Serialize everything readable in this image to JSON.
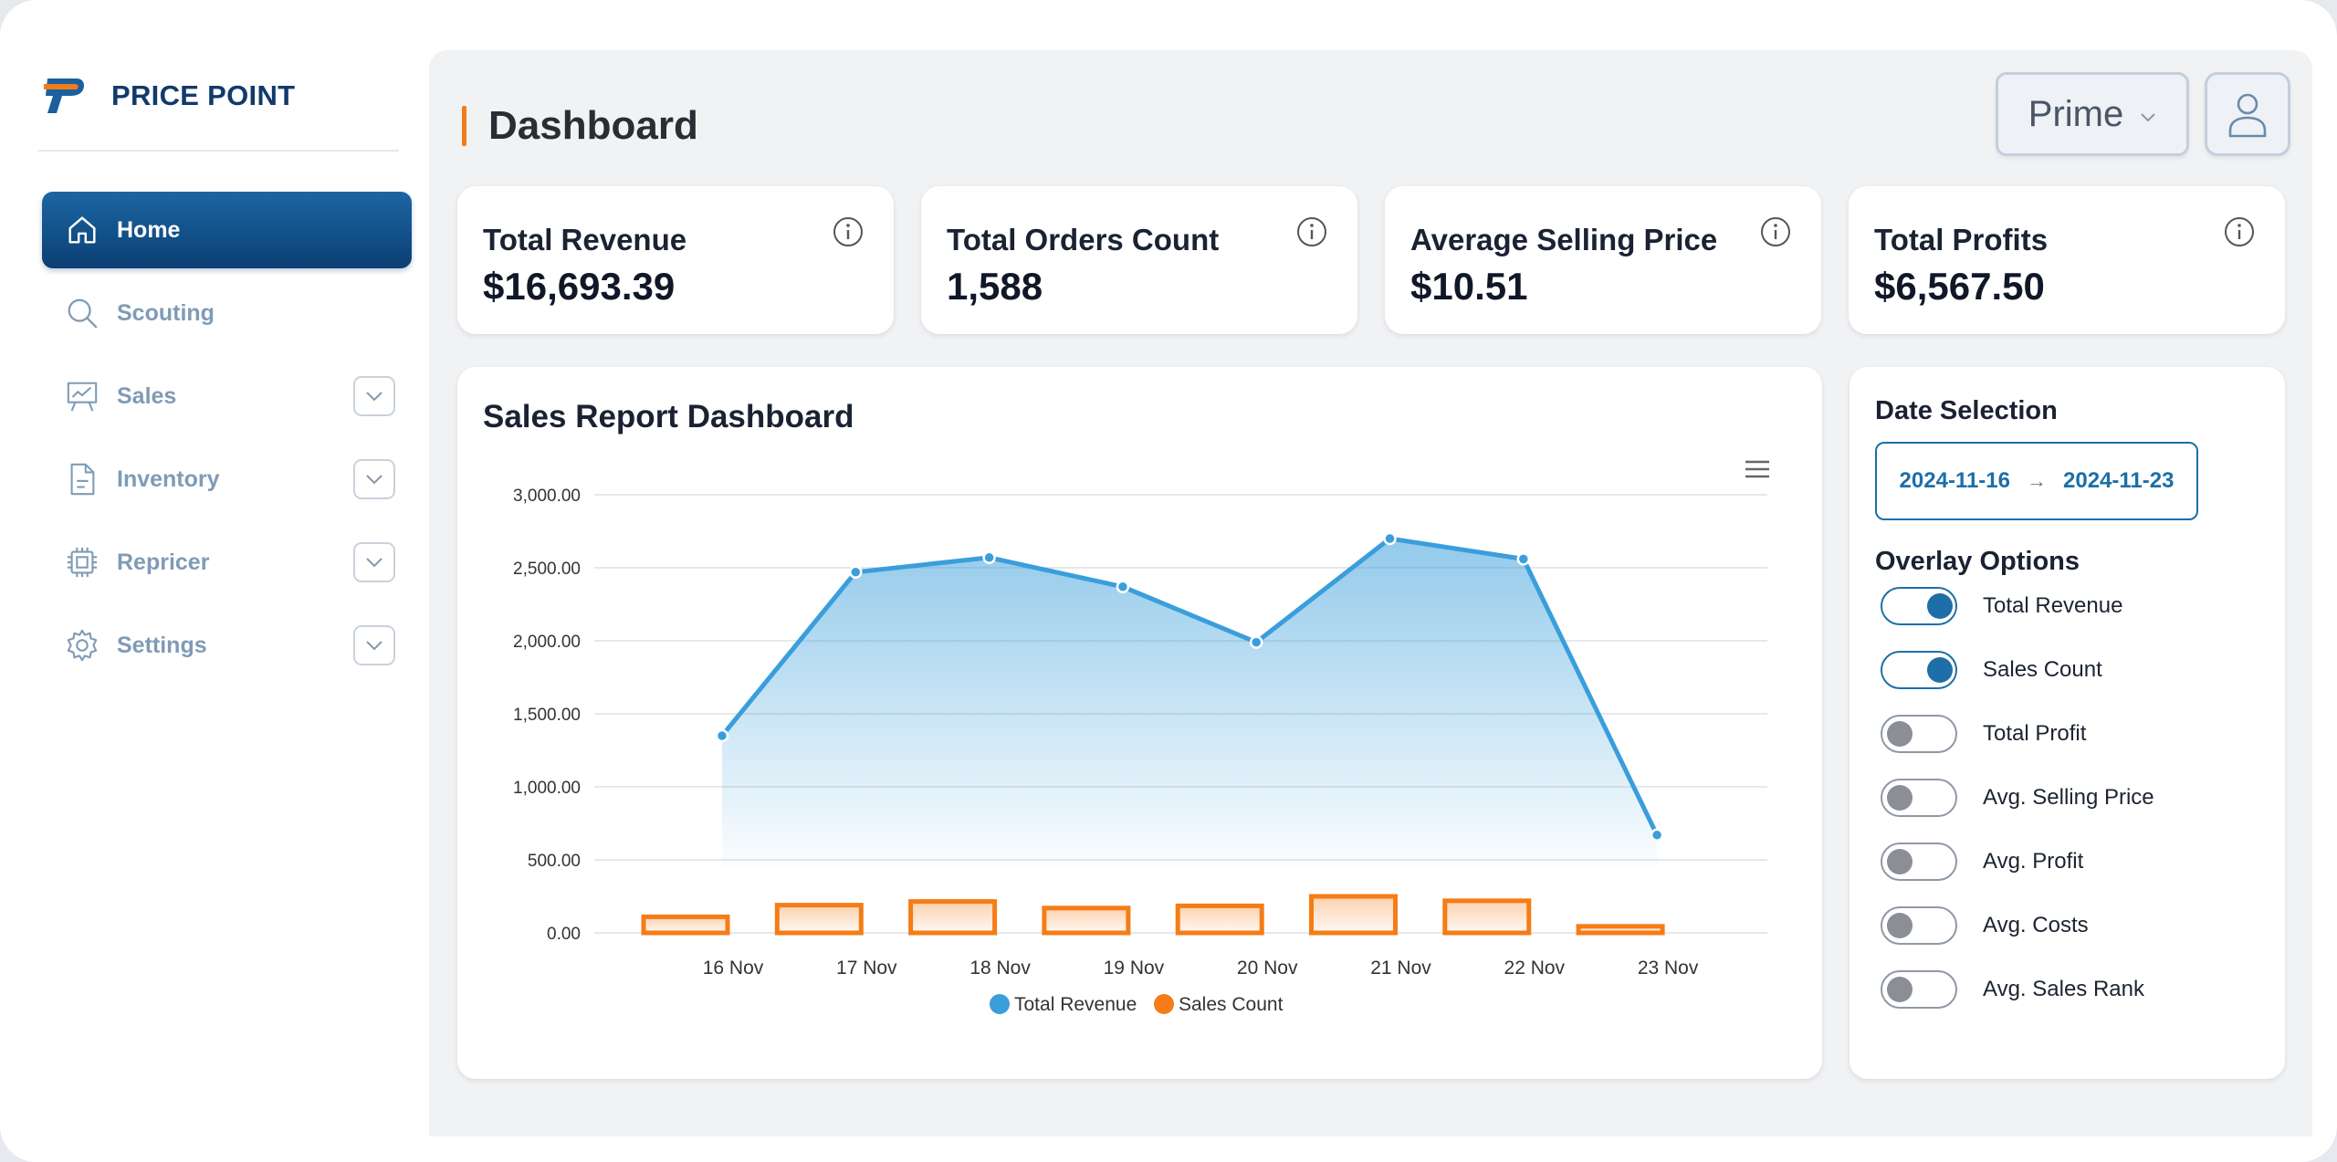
{
  "brand": {
    "name": "PRICE POINT"
  },
  "sidebar": {
    "items": [
      {
        "label": "Home",
        "icon": "home-icon",
        "active": true,
        "has_dropdown": false
      },
      {
        "label": "Scouting",
        "icon": "search-icon",
        "active": false,
        "has_dropdown": false
      },
      {
        "label": "Sales",
        "icon": "presentation-chart-icon",
        "active": false,
        "has_dropdown": true
      },
      {
        "label": "Inventory",
        "icon": "document-icon",
        "active": false,
        "has_dropdown": true
      },
      {
        "label": "Repricer",
        "icon": "chip-icon",
        "active": false,
        "has_dropdown": true
      },
      {
        "label": "Settings",
        "icon": "gear-icon",
        "active": false,
        "has_dropdown": true
      }
    ]
  },
  "header": {
    "title": "Dashboard",
    "plan_select": "Prime"
  },
  "kpis": [
    {
      "label": "Total Revenue",
      "value": "$16,693.39"
    },
    {
      "label": "Total Orders Count",
      "value": "1,588"
    },
    {
      "label": "Average Selling Price",
      "value": "$10.51"
    },
    {
      "label": "Total Profits",
      "value": "$6,567.50"
    }
  ],
  "chart_card": {
    "title": "Sales Report Dashboard"
  },
  "chart_data": {
    "type": "area",
    "categories": [
      "16 Nov",
      "17 Nov",
      "18 Nov",
      "19 Nov",
      "20 Nov",
      "21 Nov",
      "22 Nov",
      "23 Nov"
    ],
    "series": [
      {
        "name": "Total Revenue",
        "type": "area",
        "color": "#3a9edb",
        "values": [
          1350,
          2470,
          2570,
          2370,
          1990,
          2700,
          2560,
          670
        ]
      },
      {
        "name": "Sales Count",
        "type": "bar",
        "color": "#f57c16",
        "values": [
          110,
          190,
          215,
          170,
          185,
          250,
          220,
          45
        ]
      }
    ],
    "y_ticks": [
      "3,000.00",
      "2,500.00",
      "2,000.00",
      "1,500.00",
      "1,000.00",
      "500.00",
      "0.00"
    ],
    "ylim": [
      0,
      3000
    ],
    "grid": true,
    "legend": "bottom-center"
  },
  "date_selection": {
    "title": "Date Selection",
    "start": "2024-11-16",
    "end": "2024-11-23"
  },
  "overlay": {
    "title": "Overlay Options",
    "options": [
      {
        "label": "Total Revenue",
        "on": true
      },
      {
        "label": "Sales Count",
        "on": true
      },
      {
        "label": "Total Profit",
        "on": false
      },
      {
        "label": "Avg. Selling Price",
        "on": false
      },
      {
        "label": "Avg. Profit",
        "on": false
      },
      {
        "label": "Avg. Costs",
        "on": false
      },
      {
        "label": "Avg. Sales Rank",
        "on": false
      }
    ]
  },
  "colors": {
    "accent": "#0b3f74",
    "brand_orange": "#f07c1b",
    "revenue": "#3a9edb",
    "sales": "#f57c16"
  }
}
